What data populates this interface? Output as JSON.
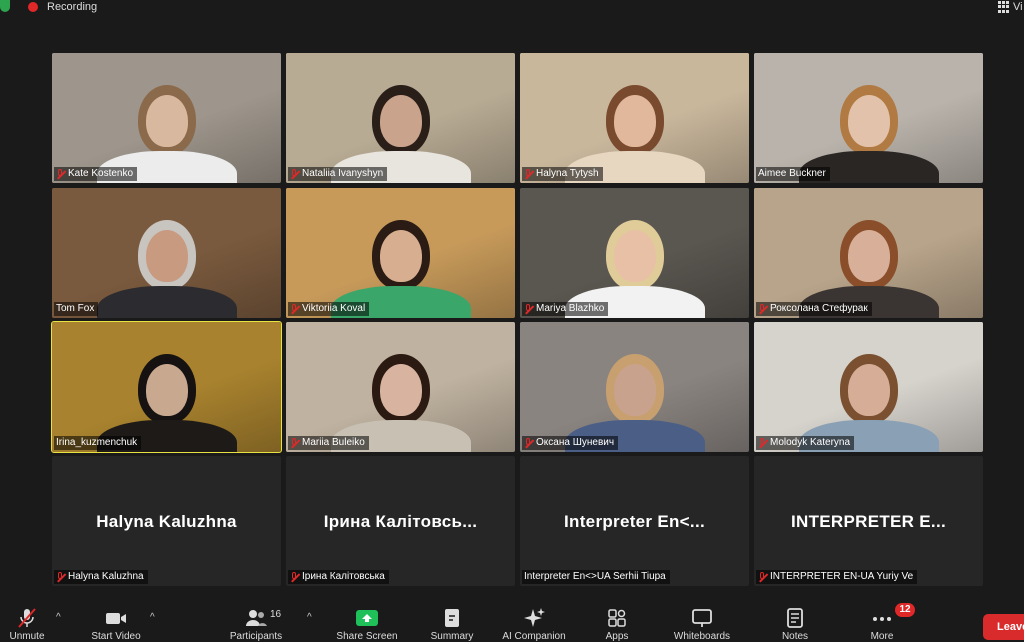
{
  "topbar": {
    "recording_label": "Recording",
    "view_label": "Vi"
  },
  "participants": [
    {
      "name": "Kate Kostenko",
      "muted": true,
      "bg": "#9e968c",
      "skin": "#d9b8a0",
      "hair": "#8a6a4a",
      "shirt": "#ececec"
    },
    {
      "name": "Nataliia Ivanyshyn",
      "muted": true,
      "bg": "#b8ab94",
      "skin": "#caa38c",
      "hair": "#2a1e18",
      "shirt": "#e8e4de"
    },
    {
      "name": "Halyna Tytysh",
      "muted": true,
      "bg": "#c9b79c",
      "skin": "#e1b89c",
      "hair": "#7a4a2e",
      "shirt": "#e7d6c0"
    },
    {
      "name": "Aimee Buckner",
      "muted": false,
      "bg": "#b9b3ab",
      "skin": "#e2c2aa",
      "hair": "#b07a42",
      "shirt": "#2a2624"
    },
    {
      "name": "Tom Fox",
      "muted": false,
      "bg": "#7a5a3e",
      "skin": "#c89a80",
      "hair": "#c8c4c0",
      "shirt": "#2c2c30"
    },
    {
      "name": "Viktoriia Koval",
      "muted": true,
      "bg": "#c79a5a",
      "skin": "#d8ae90",
      "hair": "#2a1c14",
      "shirt": "#3aa66a"
    },
    {
      "name": "Mariya Blazhko",
      "muted": true,
      "bg": "#5a5650",
      "skin": "#e8c0a6",
      "hair": "#e0cc98",
      "shirt": "#f2f2f2"
    },
    {
      "name": "Роксолана Стефурак",
      "muted": true,
      "bg": "#b8a48a",
      "skin": "#d8b09a",
      "hair": "#8a4e2a",
      "shirt": "#3a3432"
    },
    {
      "name": "Irina_kuzmenchuk",
      "muted": false,
      "speaking": true,
      "bg": "#a8822e",
      "skin": "#c9a890",
      "hair": "#161212",
      "shirt": "#1e1a18"
    },
    {
      "name": "Mariia Buleiko",
      "muted": true,
      "bg": "#bfb2a0",
      "skin": "#d8b4a0",
      "hair": "#2a1a12",
      "shirt": "#c9c0b4"
    },
    {
      "name": "Оксана Шуневич",
      "muted": true,
      "bg": "#8a8480",
      "skin": "#c8a28c",
      "hair": "#c8a070",
      "shirt": "#4a5e86"
    },
    {
      "name": "Molodyk Kateryna",
      "muted": true,
      "bg": "#d6d2cc",
      "skin": "#d6ae98",
      "hair": "#7a5030",
      "shirt": "#8aa0b4"
    },
    {
      "name": "Halyna Kaluzhna",
      "display": "Halyna Kaluzhna",
      "muted": true,
      "camera_off": true
    },
    {
      "name": "Ірина Калітовська",
      "display": "Ірина  Калітовсь...",
      "muted": true,
      "camera_off": true
    },
    {
      "name": "Interpreter En<>UA Serhii Tiupa",
      "display": "Interpreter  En<...",
      "muted": false,
      "camera_off": true
    },
    {
      "name": "INTERPRETER EN-UA Yuriy Ve",
      "display": "INTERPRETER  E...",
      "muted": true,
      "camera_off": true
    }
  ],
  "toolbar": {
    "items": [
      {
        "key": "mute",
        "label": "Unmute",
        "icon": "mic-off-icon"
      },
      {
        "key": "video",
        "label": "Start Video",
        "icon": "video-camera-icon"
      },
      {
        "key": "participants",
        "label": "Participants",
        "icon": "participants-icon",
        "count": "16"
      },
      {
        "key": "share",
        "label": "Share Screen",
        "icon": "share-screen-icon"
      },
      {
        "key": "summary",
        "label": "Summary",
        "icon": "summary-icon"
      },
      {
        "key": "ai",
        "label": "AI Companion",
        "icon": "sparkle-icon"
      },
      {
        "key": "apps",
        "label": "Apps",
        "icon": "apps-icon"
      },
      {
        "key": "whiteboards",
        "label": "Whiteboards",
        "icon": "whiteboard-icon"
      },
      {
        "key": "notes",
        "label": "Notes",
        "icon": "notes-icon"
      },
      {
        "key": "more",
        "label": "More",
        "icon": "more-icon",
        "badge": "12"
      }
    ],
    "leave_label": "Leave"
  },
  "colors": {
    "speaking_outline": "#e6e342",
    "mute_red": "#e02828",
    "share_green": "#1fbf5a",
    "leave_red": "#d92b2b"
  }
}
